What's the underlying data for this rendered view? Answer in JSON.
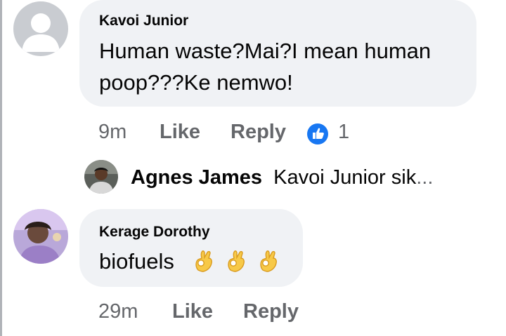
{
  "comments": [
    {
      "author": "Kavoi Junior",
      "text_line1": "Human waste?Mai?I mean human",
      "text_line2": "poop???Ke nemwo!",
      "time": "9m",
      "like_label": "Like",
      "reply_label": "Reply",
      "like_count": "1"
    },
    {
      "author": "Kerage Dorothy",
      "text": "biofuels",
      "emojis": [
        "ok-hand-emoji",
        "ok-hand-emoji",
        "ok-hand-emoji"
      ],
      "time": "29m",
      "like_label": "Like",
      "reply_label": "Reply"
    }
  ],
  "reply_preview": {
    "author": "Agnes James",
    "text": "Kavoi Junior sik",
    "ellipsis": "..."
  },
  "colors": {
    "bubble": "#f0f2f5",
    "meta_text": "#65676b",
    "like_blue": "#1877f2"
  }
}
